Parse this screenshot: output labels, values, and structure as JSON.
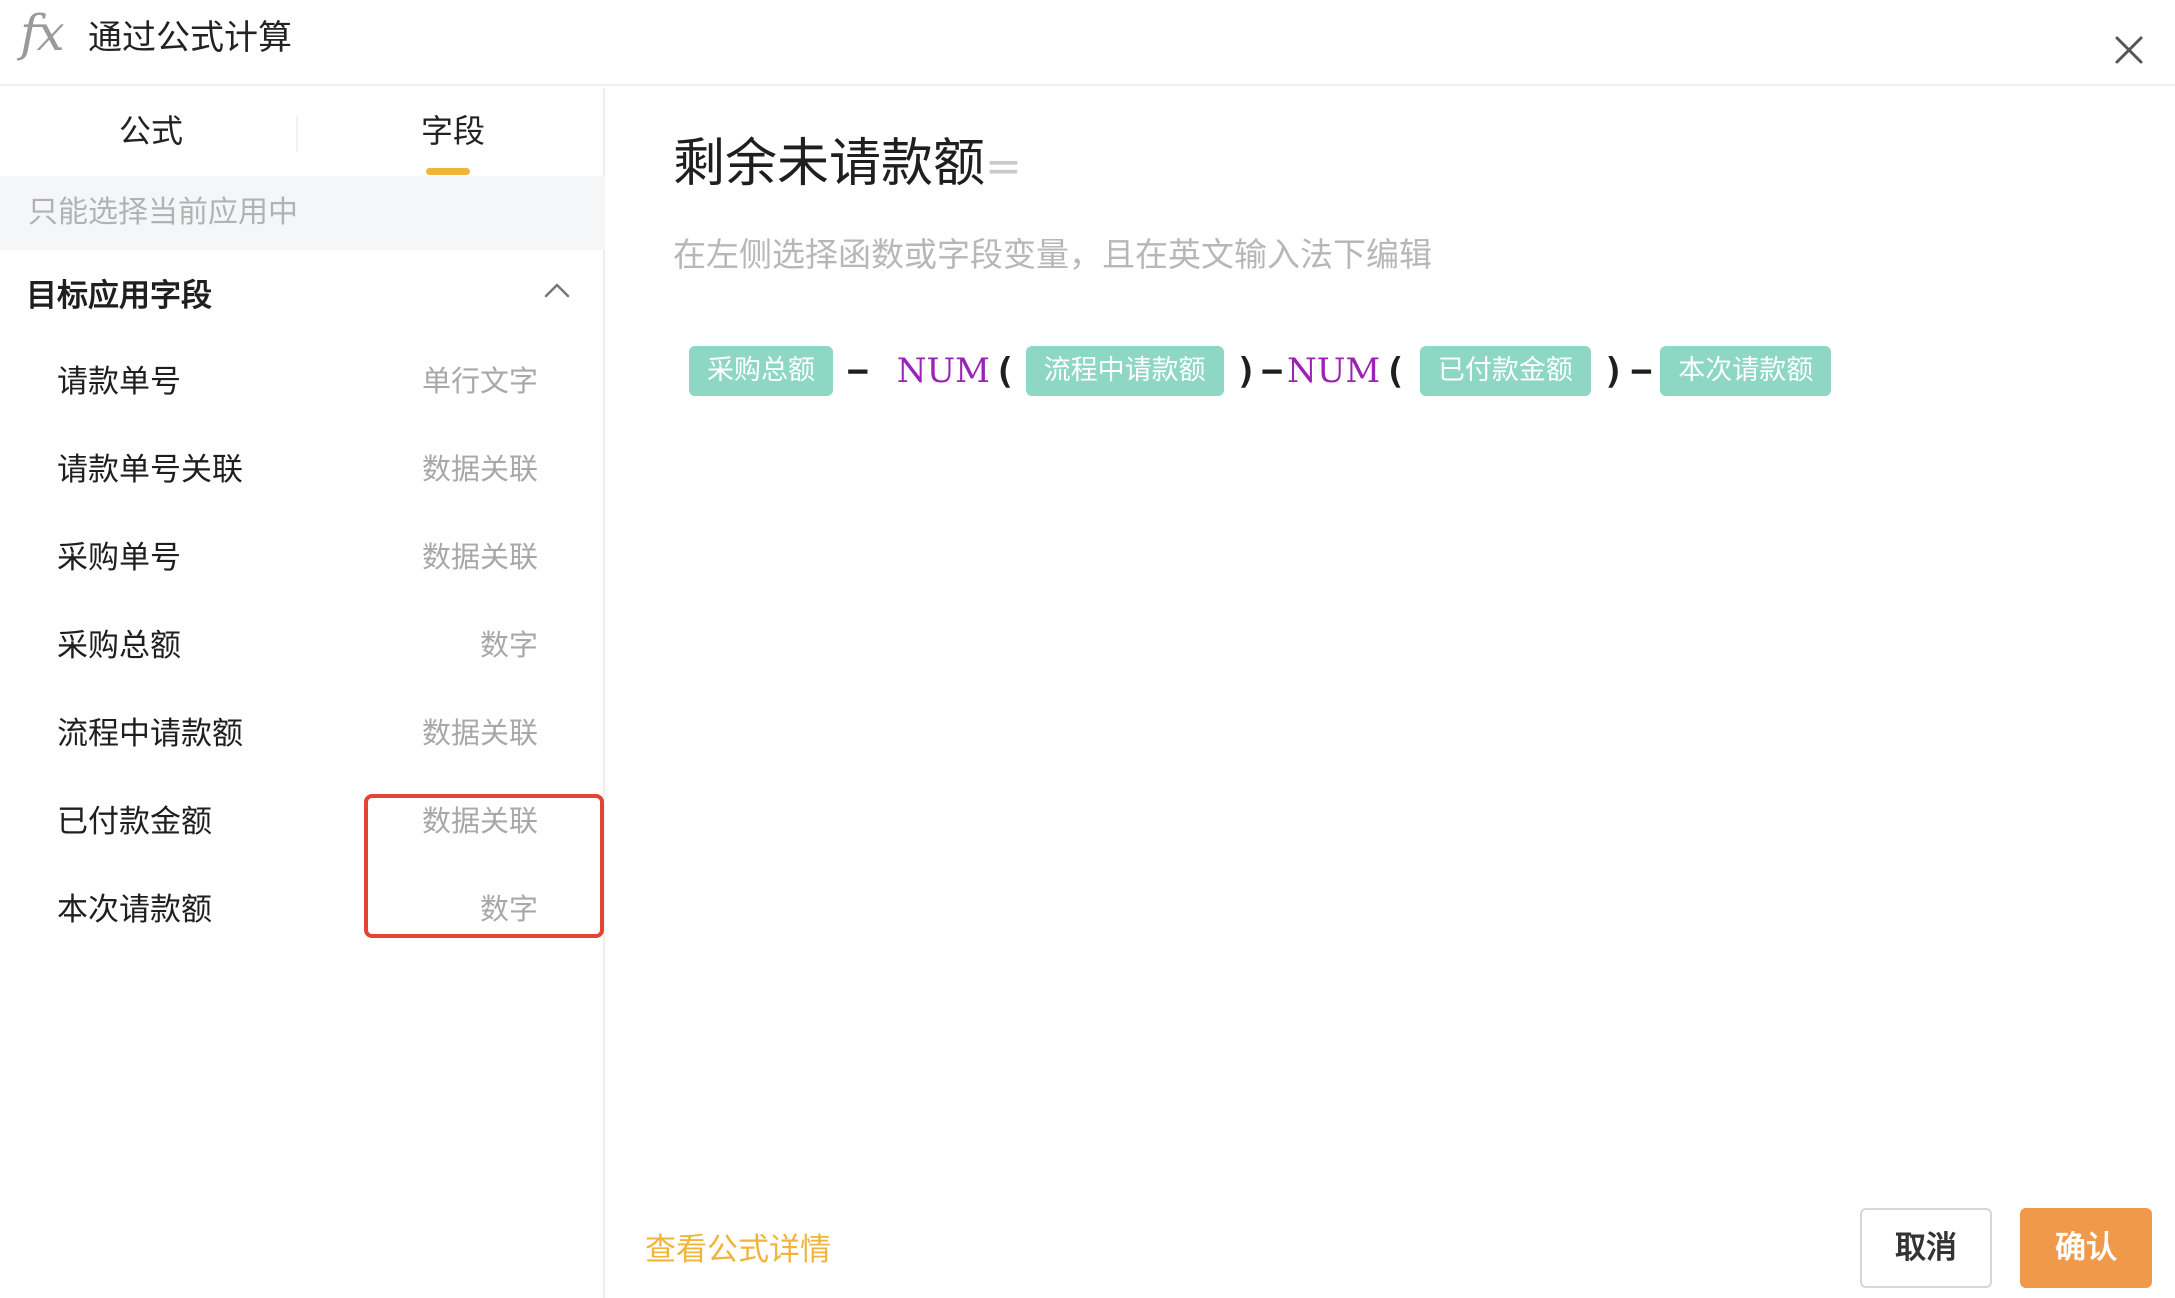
{
  "header": {
    "icon_text": "fx",
    "title": "通过公式计算"
  },
  "tabs": [
    {
      "label": "公式",
      "active": false
    },
    {
      "label": "字段",
      "active": true
    }
  ],
  "filter_hint": "只能选择当前应用中",
  "group": {
    "title": "目标应用字段",
    "expanded": true
  },
  "fields": [
    {
      "name": "请款单号",
      "type": "单行文字"
    },
    {
      "name": "请款单号关联",
      "type": "数据关联"
    },
    {
      "name": "采购单号",
      "type": "数据关联"
    },
    {
      "name": "采购总额",
      "type": "数字"
    },
    {
      "name": "流程中请款额",
      "type": "数据关联"
    },
    {
      "name": "已付款金额",
      "type": "数据关联"
    },
    {
      "name": "本次请款额",
      "type": "数字"
    }
  ],
  "editor": {
    "target_field": "剩余未请款额",
    "equals": "=",
    "hint": "在左侧选择函数或字段变量，且在英文输入法下编辑",
    "formula": {
      "f1": "采购总额",
      "op1": "−",
      "fn1": "NUM",
      "lp1": "(",
      "f2": "流程中请款额",
      "rp1": ")",
      "op2": "−",
      "fn2": "NUM",
      "lp2": "(",
      "f3": "已付款金额",
      "rp2": ")",
      "op3": "−",
      "f4": "本次请款额"
    }
  },
  "footer": {
    "view_details": "查看公式详情",
    "cancel": "取消",
    "confirm": "确认"
  },
  "colors": {
    "accent": "#f0b43c",
    "confirm_bg": "#f0994a",
    "chip_bg": "#8ed7c4",
    "function": "#9c22b5",
    "highlight_border": "#e04535"
  }
}
